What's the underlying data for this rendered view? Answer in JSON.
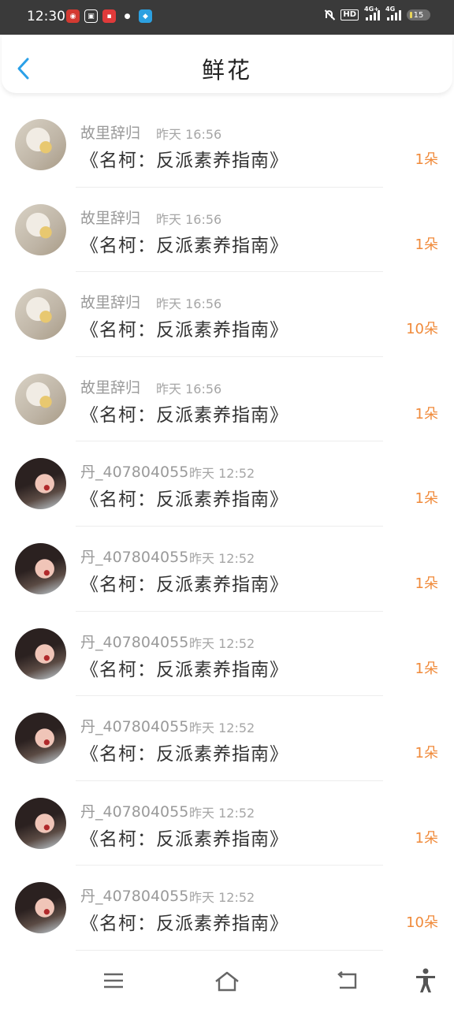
{
  "status_bar": {
    "time": "12:30",
    "app_icons": [
      {
        "name": "netease-music-icon",
        "color": "#d33a31",
        "glyph": "◉"
      },
      {
        "name": "screen-icon",
        "color": "#ffffff",
        "glyph": "▣"
      },
      {
        "name": "app-red-icon",
        "color": "#e03a3a",
        "glyph": "▪"
      },
      {
        "name": "wechat-icon",
        "color": "#3a3a3a",
        "glyph": "●"
      },
      {
        "name": "app-blue-icon",
        "color": "#2ca0e0",
        "glyph": "◆"
      }
    ],
    "hd_label": "HD",
    "signal1_label": "4G+",
    "signal2_label": "4G",
    "battery": "15"
  },
  "header": {
    "title": "鲜花"
  },
  "accent": "#f08a3a",
  "flowers": [
    {
      "user": "故里辞归",
      "time": "昨天 16:56",
      "book": "《名柯：反派素养指南》",
      "count": "1朵",
      "avatar": "a"
    },
    {
      "user": "故里辞归",
      "time": "昨天 16:56",
      "book": "《名柯：反派素养指南》",
      "count": "1朵",
      "avatar": "a"
    },
    {
      "user": "故里辞归",
      "time": "昨天 16:56",
      "book": "《名柯：反派素养指南》",
      "count": "10朵",
      "avatar": "a"
    },
    {
      "user": "故里辞归",
      "time": "昨天 16:56",
      "book": "《名柯：反派素养指南》",
      "count": "1朵",
      "avatar": "a"
    },
    {
      "user": "丹_407804055",
      "time": "昨天 12:52",
      "book": "《名柯：反派素养指南》",
      "count": "1朵",
      "avatar": "b"
    },
    {
      "user": "丹_407804055",
      "time": "昨天 12:52",
      "book": "《名柯：反派素养指南》",
      "count": "1朵",
      "avatar": "b"
    },
    {
      "user": "丹_407804055",
      "time": "昨天 12:52",
      "book": "《名柯：反派素养指南》",
      "count": "1朵",
      "avatar": "b"
    },
    {
      "user": "丹_407804055",
      "time": "昨天 12:52",
      "book": "《名柯：反派素养指南》",
      "count": "1朵",
      "avatar": "b"
    },
    {
      "user": "丹_407804055",
      "time": "昨天 12:52",
      "book": "《名柯：反派素养指南》",
      "count": "1朵",
      "avatar": "b"
    },
    {
      "user": "丹_407804055",
      "time": "昨天 12:52",
      "book": "《名柯：反派素养指南》",
      "count": "10朵",
      "avatar": "b"
    }
  ],
  "nav_icons": [
    "menu-icon",
    "home-icon",
    "back-nav-icon",
    "accessibility-icon"
  ]
}
